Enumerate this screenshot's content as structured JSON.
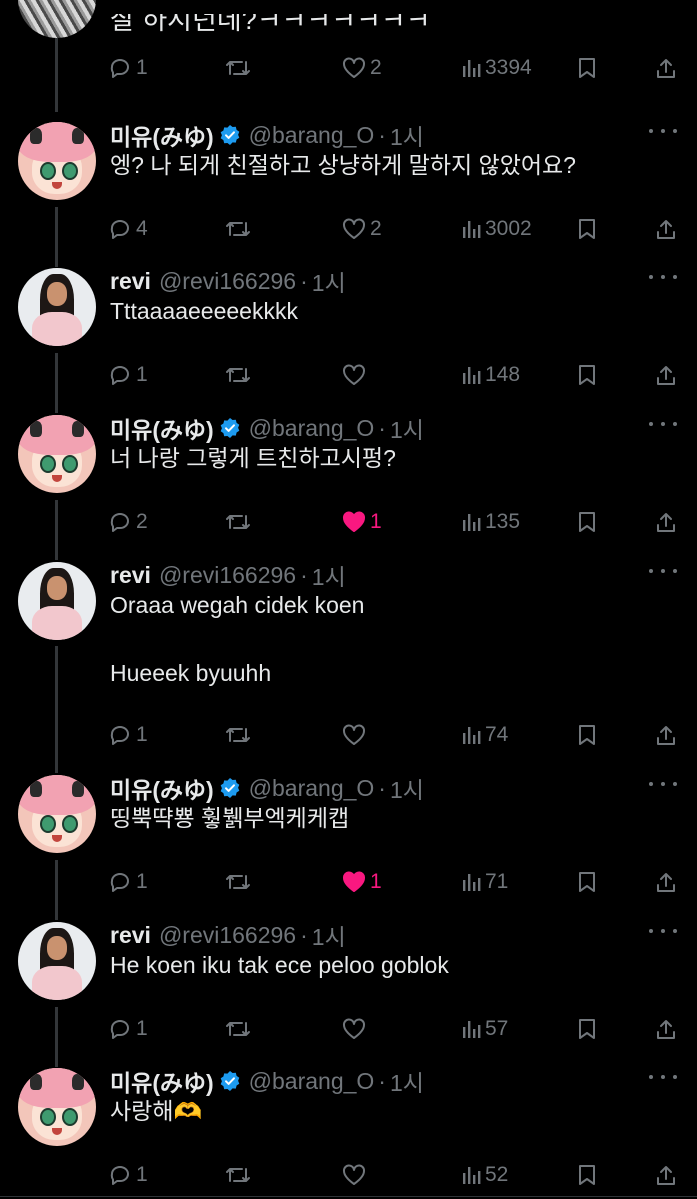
{
  "partial": {
    "text": "잘 하시던데?ㅋㅋㅋㅋㅋㅋㅋ",
    "reply_count": "1",
    "retweet_count": "",
    "like_count": "2",
    "view_count": "3394"
  },
  "tweets": [
    {
      "author": "미유(みゆ)",
      "handle": "@barang_O",
      "time": "1시",
      "verified": true,
      "text": "엥? 나 되게 친절하고 상냥하게 말하지 않았어요?",
      "text2": "",
      "reply_count": "4",
      "retweet_count": "",
      "like_count": "2",
      "liked": false,
      "view_count": "3002"
    },
    {
      "author": "revi",
      "handle": "@revi166296",
      "time": "1시",
      "verified": false,
      "text": "Tttaaaaeeeeekkkk",
      "text2": "",
      "reply_count": "1",
      "retweet_count": "",
      "like_count": "",
      "liked": false,
      "view_count": "148"
    },
    {
      "author": "미유(みゆ)",
      "handle": "@barang_O",
      "time": "1시",
      "verified": true,
      "text": "너 나랑 그렇게 트친하고시펑?",
      "text2": "",
      "reply_count": "2",
      "retweet_count": "",
      "like_count": "1",
      "liked": true,
      "view_count": "135"
    },
    {
      "author": "revi",
      "handle": "@revi166296",
      "time": "1시",
      "verified": false,
      "text": "Oraaa wegah cidek koen",
      "text2": "Hueeek byuuhh",
      "reply_count": "1",
      "retweet_count": "",
      "like_count": "",
      "liked": false,
      "view_count": "74"
    },
    {
      "author": "미유(みゆ)",
      "handle": "@barang_O",
      "time": "1시",
      "verified": true,
      "text": "띵뿍땩뿅 훻뷁부엑케케캡",
      "text2": "",
      "reply_count": "1",
      "retweet_count": "",
      "like_count": "1",
      "liked": true,
      "view_count": "71"
    },
    {
      "author": "revi",
      "handle": "@revi166296",
      "time": "1시",
      "verified": false,
      "text": "He koen iku tak ece peloo goblok",
      "text2": "",
      "reply_count": "1",
      "retweet_count": "",
      "like_count": "",
      "liked": false,
      "view_count": "57"
    },
    {
      "author": "미유(みゆ)",
      "handle": "@barang_O",
      "time": "1시",
      "verified": true,
      "text": "사랑해🫶",
      "text2": "",
      "reply_count": "1",
      "retweet_count": "",
      "like_count": "",
      "liked": false,
      "view_count": "52"
    }
  ],
  "colors": {
    "background": "#000000",
    "text": "#e7e9ea",
    "muted": "#71767b",
    "like": "#f91880",
    "verified": "#1d9bf0",
    "thread_line": "#333639"
  },
  "icons": [
    "reply-icon",
    "retweet-icon",
    "like-icon",
    "views-icon",
    "bookmark-icon",
    "share-icon",
    "verified-badge-icon",
    "more-icon"
  ]
}
